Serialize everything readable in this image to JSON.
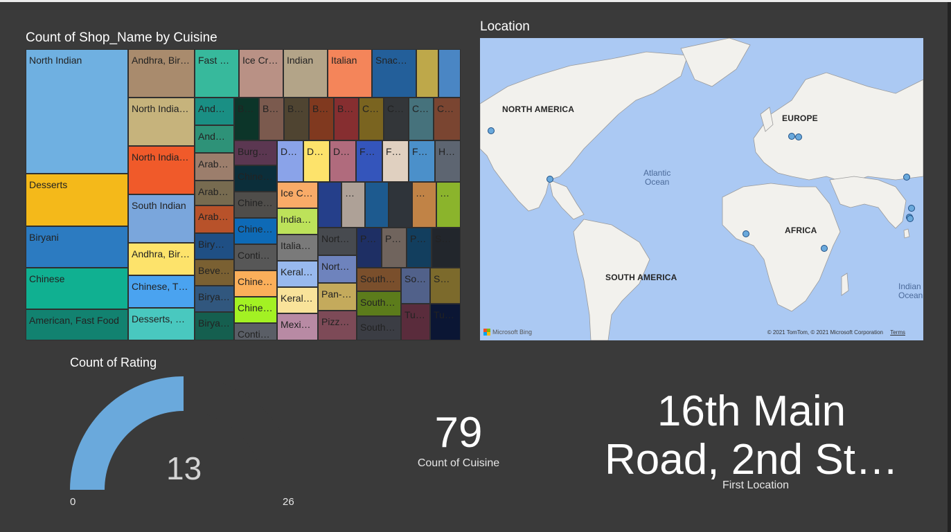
{
  "treemap": {
    "title": "Count of Shop_Name by Cuisine",
    "tiles": [
      {
        "label": "North Indian",
        "color": "#6fb0e1"
      },
      {
        "label": "Desserts",
        "color": "#f4b91a"
      },
      {
        "label": "Biryani",
        "color": "#2c7bc1"
      },
      {
        "label": "Chinese",
        "color": "#10b091"
      },
      {
        "label": "American, Fast Food",
        "color": "#128270"
      },
      {
        "label": "Andhra, Bir…",
        "color": "#a98b6d"
      },
      {
        "label": "North India…",
        "color": "#c6b37c"
      },
      {
        "label": "North India…",
        "color": "#f05a2a"
      },
      {
        "label": "South Indian",
        "color": "#7aa6dc"
      },
      {
        "label": "Andhra, Bir…",
        "color": "#fde36b"
      },
      {
        "label": "Chinese, T…",
        "color": "#4aa3f0"
      },
      {
        "label": "Desserts, …",
        "color": "#49c8bf"
      },
      {
        "label": "Fast …",
        "color": "#37b99c"
      },
      {
        "label": "Ice Cr…",
        "color": "#b99185"
      },
      {
        "label": "Indian",
        "color": "#b3a488"
      },
      {
        "label": "Italian",
        "color": "#f4855a"
      },
      {
        "label": "Snac…",
        "color": "#235f9a"
      },
      {
        "label": "",
        "color": "#bea84a"
      },
      {
        "label": "",
        "color": "#4a86c4"
      },
      {
        "label": "And…",
        "color": "#1a8f84"
      },
      {
        "label": "And…",
        "color": "#2e9278"
      },
      {
        "label": "Arab…",
        "color": "#9c7e6c"
      },
      {
        "label": "Arab…",
        "color": "#776b50"
      },
      {
        "label": "Arab…",
        "color": "#b8522a"
      },
      {
        "label": "Biry…",
        "color": "#1f4f84"
      },
      {
        "label": "Beve…",
        "color": "#7a6032"
      },
      {
        "label": "Birya…",
        "color": "#31577e"
      },
      {
        "label": "Birya…",
        "color": "#155f4f"
      },
      {
        "label": "B…",
        "color": "#0c3529"
      },
      {
        "label": "B…",
        "color": "#7b5a4e"
      },
      {
        "label": "B…",
        "color": "#4f4431"
      },
      {
        "label": "B…",
        "color": "#80391f"
      },
      {
        "label": "B…",
        "color": "#862e30"
      },
      {
        "label": "C…",
        "color": "#7a6420"
      },
      {
        "label": "C…",
        "color": "#333639"
      },
      {
        "label": "C…",
        "color": "#46727c"
      },
      {
        "label": "C…",
        "color": "#7a4531"
      },
      {
        "label": "Burg…",
        "color": "#5b3751"
      },
      {
        "label": "Chine…",
        "color": "#0b2e3a"
      },
      {
        "label": "Chine…",
        "color": "#4f4d4a"
      },
      {
        "label": "Chine…",
        "color": "#0e6ab6"
      },
      {
        "label": "Conti…",
        "color": "#575757"
      },
      {
        "label": "Chine…",
        "color": "#fbaf5a"
      },
      {
        "label": "Chine…",
        "color": "#a3f123"
      },
      {
        "label": "Conti…",
        "color": "#5a5e66"
      },
      {
        "label": "D…",
        "color": "#8aa3e9"
      },
      {
        "label": "D…",
        "color": "#fde36b"
      },
      {
        "label": "D…",
        "color": "#b06b7d"
      },
      {
        "label": "F…",
        "color": "#3455bb"
      },
      {
        "label": "F…",
        "color": "#e0d0c0"
      },
      {
        "label": "F…",
        "color": "#4b90ca"
      },
      {
        "label": "H…",
        "color": "#5d6571"
      },
      {
        "label": "Ice C…",
        "color": "#f9ab68"
      },
      {
        "label": "India…",
        "color": "#bde25a"
      },
      {
        "label": "Italia…",
        "color": "#7a7a7a"
      },
      {
        "label": "Keral…",
        "color": "#98b9ee"
      },
      {
        "label": "Keral…",
        "color": "#f9e39a"
      },
      {
        "label": "Mexi…",
        "color": "#b88aa4"
      },
      {
        "label": "",
        "color": "#253f8a"
      },
      {
        "label": "…",
        "color": "#aea197"
      },
      {
        "label": "",
        "color": "#1d5a8f"
      },
      {
        "label": "",
        "color": "#2f343a"
      },
      {
        "label": "…",
        "color": "#c18346"
      },
      {
        "label": "…",
        "color": "#8bb42c"
      },
      {
        "label": "Nort…",
        "color": "#474a4f"
      },
      {
        "label": "Nort…",
        "color": "#6e83bd"
      },
      {
        "label": "Pan-…",
        "color": "#c4aa5c"
      },
      {
        "label": "Pizz…",
        "color": "#7d4a57"
      },
      {
        "label": "Pi…",
        "color": "#1e2f64"
      },
      {
        "label": "Pi…",
        "color": "#70645d"
      },
      {
        "label": "P…",
        "color": "#123e5e"
      },
      {
        "label": "S…",
        "color": "#22262c"
      },
      {
        "label": "South…",
        "color": "#7a4f2c"
      },
      {
        "label": "South…",
        "color": "#5c7c1b"
      },
      {
        "label": "South…",
        "color": "#3b3d44"
      },
      {
        "label": "So…",
        "color": "#51618a"
      },
      {
        "label": "S…",
        "color": "#7c6a2c"
      },
      {
        "label": "Tu…",
        "color": "#5a2c3c"
      },
      {
        "label": "Tu…",
        "color": "#0b1634"
      }
    ]
  },
  "map": {
    "title": "Location",
    "labels": {
      "north_america": "NORTH AMERICA",
      "europe": "EUROPE",
      "africa": "AFRICA",
      "south_america": "SOUTH AMERICA",
      "atlantic_1": "Atlantic",
      "atlantic_2": "Ocean",
      "indian_1": "Indian",
      "indian_2": "Ocean"
    },
    "attribution": "© 2021 TomTom, © 2021 Microsoft Corporation",
    "terms": "Terms",
    "bing": "Microsoft Bing"
  },
  "gauge": {
    "title": "Count of Rating",
    "value": 13,
    "value_label": "13",
    "min_label": "0",
    "max_label": "26",
    "min": 0,
    "max": 26,
    "fill_color": "#6aa9dc"
  },
  "card_cuisine": {
    "value": "79",
    "label": "Count of Cuisine"
  },
  "card_location": {
    "line1": "16th Main",
    "line2": "Road, 2nd St…",
    "label": "First Location"
  }
}
